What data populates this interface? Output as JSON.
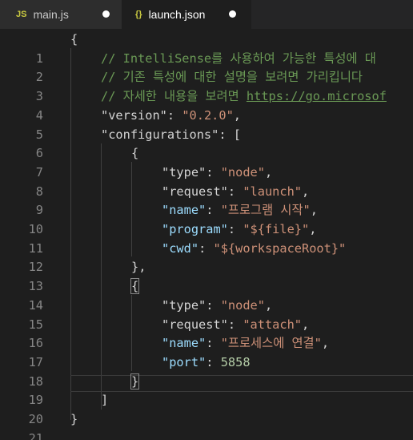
{
  "tabs": [
    {
      "icon": "JS",
      "label": "main.js",
      "active": false,
      "dirty": true
    },
    {
      "icon": "{}",
      "label": "launch.json",
      "active": true,
      "dirty": true
    }
  ],
  "editor": {
    "line_numbers": [
      "1",
      "2",
      "3",
      "4",
      "5",
      "6",
      "7",
      "8",
      "9",
      "10",
      "11",
      "12",
      "13",
      "14",
      "15",
      "16",
      "17",
      "18",
      "19",
      "20",
      "21"
    ],
    "comments": {
      "c1": "// IntelliSense를 사용하여 가능한 특성에 대",
      "c2": "// 기존 특성에 대한 설명을 보려면 가리킵니다",
      "c3_prefix": "// 자세한 내용을 보려면 ",
      "c3_link": "https://go.microsof"
    },
    "version": {
      "key": "\"version\"",
      "value": "\"0.2.0\""
    },
    "configurations_key": "\"configurations\"",
    "config1": {
      "type": {
        "key": "\"type\"",
        "value": "\"node\""
      },
      "request": {
        "key": "\"request\"",
        "value": "\"launch\""
      },
      "name": {
        "key": "\"name\"",
        "value": "\"프로그램 시작\""
      },
      "program": {
        "key": "\"program\"",
        "value": "\"${file}\""
      },
      "cwd": {
        "key": "\"cwd\"",
        "value": "\"${workspaceRoot}\""
      }
    },
    "config2": {
      "type": {
        "key": "\"type\"",
        "value": "\"node\""
      },
      "request": {
        "key": "\"request\"",
        "value": "\"attach\""
      },
      "name": {
        "key": "\"name\"",
        "value": "\"프로세스에 연결\""
      },
      "port": {
        "key": "\"port\"",
        "value": "5858"
      }
    }
  },
  "colors": {
    "background": "#1e1e1e",
    "string": "#ce9178",
    "property": "#9cdcfe",
    "comment": "#6a9955",
    "number": "#b5cea8",
    "js_icon": "#cbcb41",
    "json_icon": "#cbcb41"
  }
}
